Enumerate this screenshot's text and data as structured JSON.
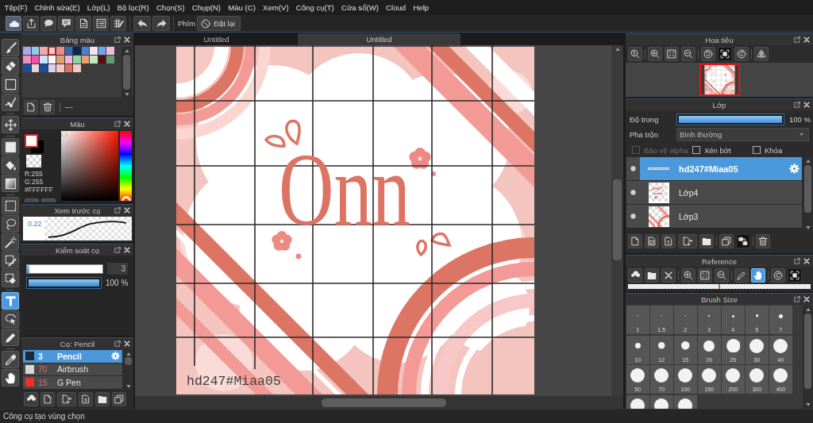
{
  "menu": [
    "Tệp(F)",
    "Chỉnh sửa(E)",
    "Lớp(L)",
    "Bộ lọc(R)",
    "Chọn(S)",
    "Chụp(N)",
    "Màu (C)",
    "Xem(V)",
    "Công cụ(T)",
    "Cửa sổ(W)",
    "Cloud",
    "Help"
  ],
  "shortcut": {
    "label": "Phím",
    "reset_button": "Đặt lại"
  },
  "tools": [
    {
      "selected": false
    },
    {
      "selected": false
    },
    {
      "selected": false
    },
    {
      "selected": false
    },
    {
      "selected": false
    },
    {
      "selected": false
    },
    {
      "selected": false
    },
    {
      "selected": false
    },
    {
      "selected": false
    },
    {
      "selected": false
    },
    {
      "selected": false
    },
    {
      "selected": false
    },
    {
      "selected": false
    },
    {
      "selected": true
    },
    {
      "selected": false
    },
    {
      "selected": false
    },
    {
      "selected": false
    },
    {
      "selected": false
    }
  ],
  "palette": {
    "title": "Bảng màu",
    "swatches": [
      {
        "color": "#a9a9e8",
        "selected": false
      },
      {
        "color": "#8ec8f0",
        "selected": false
      },
      {
        "color": "#f4a8a8",
        "selected": false
      },
      {
        "color": "#f9c4c4",
        "selected": true
      },
      {
        "color": "#f08888",
        "selected": false
      },
      {
        "color": "#2f6cb8",
        "selected": false
      },
      {
        "color": "#10244e",
        "selected": false
      },
      {
        "color": "#4a80cc",
        "selected": false
      },
      {
        "color": "#f4e4f0",
        "selected": false
      },
      {
        "color": "#6ca8ec",
        "selected": false
      },
      {
        "color": "#f4bce0",
        "selected": false
      },
      {
        "color": "#f08cc0",
        "selected": false
      },
      {
        "color": "#f050a8",
        "selected": false
      },
      {
        "color": "#c8e4f8",
        "selected": false
      },
      {
        "color": "#fafafa",
        "selected": false
      },
      {
        "color": "#e0a070",
        "selected": false
      },
      {
        "color": "#f4b0d8",
        "selected": false
      },
      {
        "color": "#90d4a0",
        "selected": false
      },
      {
        "color": "#e8a070",
        "selected": false
      },
      {
        "color": "#c4e8c4",
        "selected": false
      },
      {
        "color": "#5a0e0e",
        "selected": false
      },
      {
        "color": "#60a070",
        "selected": false
      },
      {
        "color": "#1c4c9c",
        "selected": false
      },
      {
        "color": "#e8d4d4",
        "selected": false
      },
      {
        "color": "#1c4c9c",
        "selected": false
      },
      {
        "color": "#d4d4f8",
        "selected": false
      },
      {
        "color": "#f8c4c4",
        "selected": false
      },
      {
        "color": "#e0705c",
        "selected": false
      },
      {
        "color": "#f8c8c8",
        "selected": false
      }
    ],
    "footer_text": "---"
  },
  "color": {
    "title": "Màu",
    "red": "R:255",
    "green": "G:255",
    "hex": "#FFFFFF"
  },
  "brush_preview": {
    "title": "Xem trước cọ",
    "size": "0.22"
  },
  "brush_control": {
    "title": "Kiểm soát cọ",
    "size": {
      "level": 0.03,
      "value": "3"
    },
    "opacity": {
      "level": 1,
      "reading": "100 %"
    }
  },
  "brushes": {
    "title": "Cọ: Pencil",
    "items": [
      {
        "size": "3",
        "name": "Pencil",
        "color": "#1e2838",
        "selected": true
      },
      {
        "size": "70",
        "name": "Airbrush",
        "color": "#d8d8d8",
        "selected": false
      },
      {
        "size": "15",
        "name": "G Pen",
        "color": "#f03030",
        "selected": false
      }
    ]
  },
  "canvas": {
    "tabs": [
      {
        "label": "Untitled",
        "selected": false
      },
      {
        "label": "Untitled",
        "selected": true
      }
    ],
    "lettering": "Onn",
    "signature": "hd247#Miaa05"
  },
  "navigator": {
    "title": "Hoa tiêu",
    "tools": [
      {
        "pressed": false
      },
      {
        "pressed": false
      },
      {
        "pressed": false
      },
      {
        "pressed": false
      },
      {
        "pressed": false
      },
      {
        "pressed": true
      },
      {
        "pressed": false
      },
      {
        "pressed": false
      }
    ]
  },
  "layers": {
    "title": "Lớp",
    "opacity_label": "Độ trong",
    "opacity": {
      "level": 1,
      "reading": "100 %"
    },
    "blend_label": "Pha trộn",
    "blend_value": "Bình thường",
    "options": [
      {
        "label": "Bảo vệ alpha",
        "checked": false,
        "disabled": true
      },
      {
        "label": "Xén bớt",
        "checked": false,
        "disabled": false
      },
      {
        "label": "Khóa",
        "checked": false,
        "disabled": false
      }
    ],
    "items": [
      {
        "name": "hd247#Miaa05",
        "kind": "text",
        "visible": true,
        "selected": true
      },
      {
        "name": "Lớp4",
        "kind": "image",
        "visible": true,
        "selected": false
      },
      {
        "name": "Lớp3",
        "kind": "image",
        "visible": true,
        "selected": false
      }
    ],
    "tools": [
      {
        "pressed": false
      },
      {
        "pressed": false
      },
      {
        "pressed": false
      },
      {
        "pressed": false
      },
      {
        "pressed": false
      },
      {
        "pressed": false
      },
      {
        "pressed": true
      },
      {
        "pressed": false
      }
    ]
  },
  "reference": {
    "title": "Reference",
    "tools": [
      {
        "selected": false,
        "pressed": false
      },
      {
        "selected": false,
        "pressed": false
      },
      {
        "selected": false,
        "pressed": false
      },
      {
        "selected": false,
        "pressed": false
      },
      {
        "selected": false,
        "pressed": false
      },
      {
        "selected": false,
        "pressed": false
      },
      {
        "selected": false,
        "pressed": false
      },
      {
        "selected": true,
        "pressed": false
      },
      {
        "selected": false,
        "pressed": false
      },
      {
        "selected": false,
        "pressed": true
      }
    ]
  },
  "brush_size": {
    "title": "Brush Size",
    "sizes": [
      "1",
      "1.5",
      "2",
      "3",
      "4",
      "5",
      "7",
      "10",
      "12",
      "15",
      "20",
      "25",
      "30",
      "40",
      "50",
      "70",
      "100",
      "150",
      "200",
      "300",
      "400"
    ]
  },
  "status_bar": "Công cụ tạo vùng chọn"
}
